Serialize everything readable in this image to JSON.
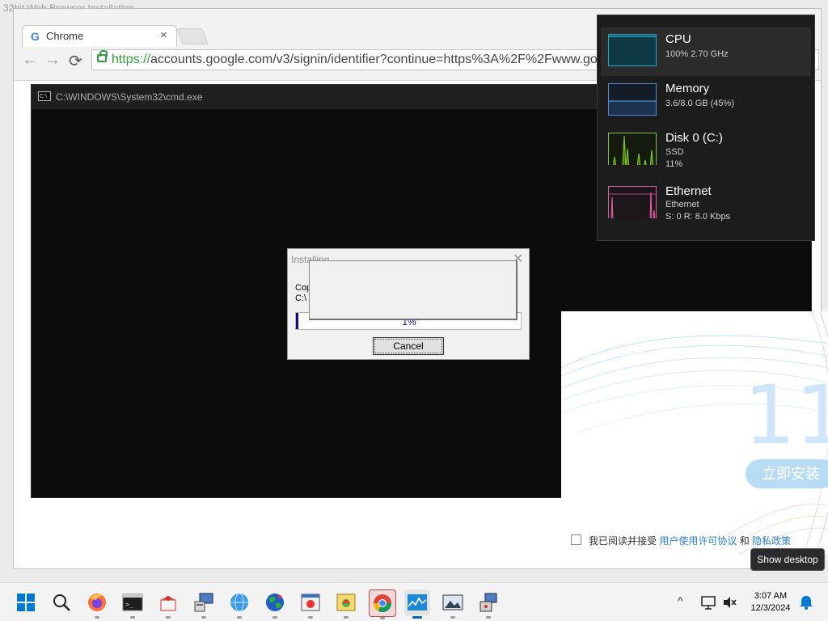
{
  "background_window": {
    "title": "32bit Web Browser Installation"
  },
  "chrome": {
    "tab_title": "Chrome",
    "tab_close": "×",
    "url_scheme": "https://",
    "url_rest": "accounts.google.com/v3/signin/identifier?continue=https%3A%2F%2Fwww.goo",
    "back_glyph": "←",
    "forward_glyph": "→",
    "reload_glyph": "⟳",
    "logo_letter": "G"
  },
  "cmd": {
    "title": "C:\\WINDOWS\\System32\\cmd.exe",
    "icon_text": "C:\\"
  },
  "install_dialog": {
    "title": "Installing",
    "close_glyph": "✕",
    "copy_line1": "Cop",
    "copy_line2": "C:\\",
    "progress_label": "1%",
    "progress_fraction": 0.01,
    "cancel_label": "Cancel"
  },
  "installer_panel": {
    "big_number": "11",
    "install_button": "立即安装",
    "agree_prefix": "我已阅读并接受",
    "link_license": "用户使用许可协议",
    "and_text": "和",
    "link_privacy": "隐私政策"
  },
  "performance": {
    "items": [
      {
        "name": "CPU",
        "sub1": "100%  2.70 GHz",
        "sub2": "",
        "color": "#1ea6c9"
      },
      {
        "name": "Memory",
        "sub1": "3.6/8.0 GB (45%)",
        "sub2": "",
        "color": "#4b8fd6"
      },
      {
        "name": "Disk 0 (C:)",
        "sub1": "SSD",
        "sub2": "11%",
        "color": "#7dc12b"
      },
      {
        "name": "Ethernet",
        "sub1": "Ethernet",
        "sub2": "S: 0 R: 8.0 Kbps",
        "color": "#d85ea0"
      }
    ]
  },
  "tooltip": {
    "text": "Show desktop"
  },
  "taskbar": {
    "apps": [
      "start",
      "search",
      "firefox",
      "terminal",
      "installer-box",
      "setup-wizard",
      "globe",
      "earth",
      "window-app",
      "photo-app",
      "chrome",
      "task-manager",
      "image-viewer",
      "setup-package"
    ],
    "active_app": "task-manager",
    "tray_chevron": "^",
    "time": "3:07 AM",
    "date": "12/3/2024"
  }
}
